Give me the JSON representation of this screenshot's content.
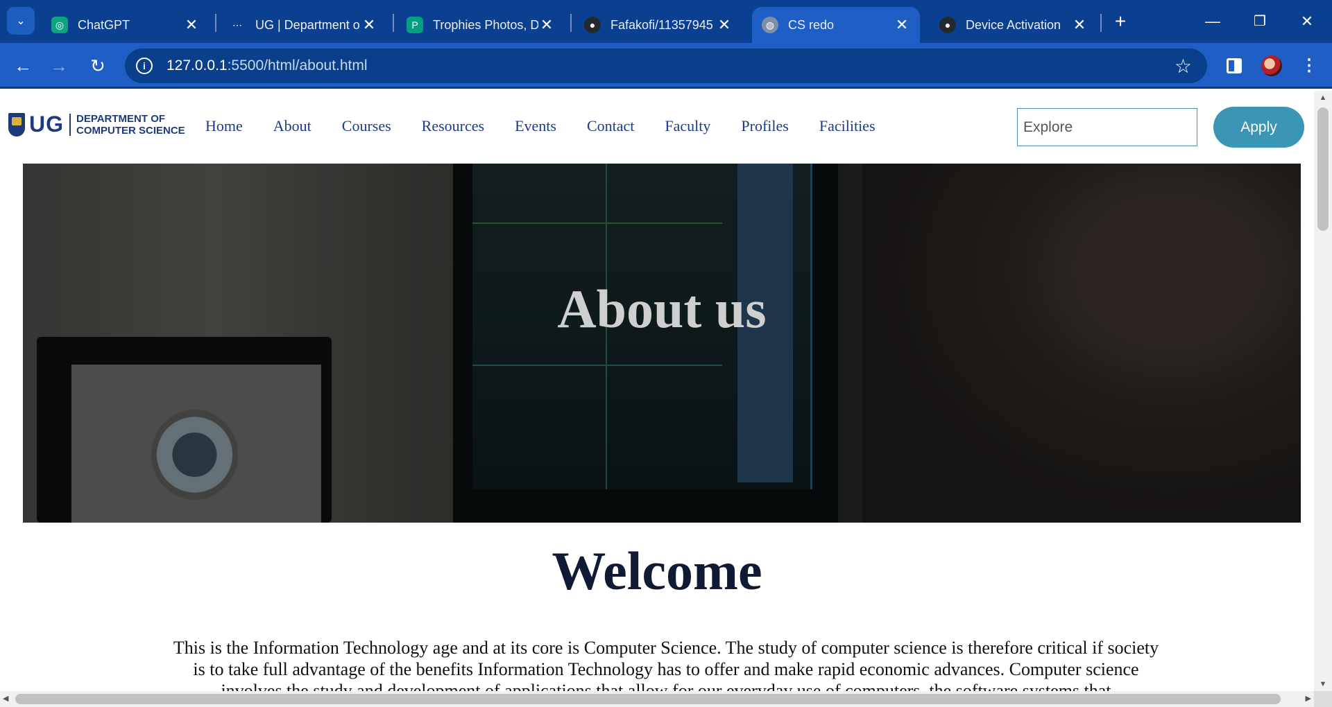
{
  "browser": {
    "tabs": [
      {
        "title": "ChatGPT",
        "icon": "chatgpt-icon",
        "color": "#10a37f"
      },
      {
        "title": "UG | Department o",
        "icon": "ug-icon",
        "color": "#0b3f8f"
      },
      {
        "title": "Trophies Photos, D",
        "icon": "pexels-icon",
        "color": "#05a081"
      },
      {
        "title": "Fafakofi/11357945",
        "icon": "github-icon",
        "color": "#24292e"
      },
      {
        "title": "CS redo",
        "icon": "globe-icon",
        "color": "#7f8fa8",
        "active": true
      },
      {
        "title": "Device Activation",
        "icon": "github-icon",
        "color": "#24292e"
      }
    ],
    "tab_close_symbol": "✕",
    "new_tab_symbol": "+",
    "url_host": "127.0.0.1",
    "url_path": ":5500/html/about.html",
    "colors": {
      "tabstrip": "#0b3f8f",
      "toolbar": "#1f5ec4",
      "omnibox": "#0a3f8c"
    }
  },
  "site": {
    "logo": {
      "abbr": "UG",
      "line1": "DEPARTMENT OF",
      "line2": "COMPUTER SCIENCE"
    },
    "nav": [
      "Home",
      "About",
      "Courses",
      "Resources",
      "Events",
      "Contact",
      "Faculty",
      "Profiles",
      "Facilities"
    ],
    "search_placeholder": "Explore",
    "apply_label": "Apply",
    "hero_title": "About us",
    "welcome_heading": "Welcome",
    "intro_text": "This is the Information Technology age and at its core is Computer Science. The study of computer science is therefore critical if society is to take full advantage of the benefits Information Technology has to offer and make rapid economic advances. Computer science involves the study and development of applications that allow for our everyday use of computers, the software systems that",
    "colors": {
      "nav_text": "#1a3b8a",
      "apply_bg": "#3a96b4",
      "heading": "#111a35"
    }
  }
}
